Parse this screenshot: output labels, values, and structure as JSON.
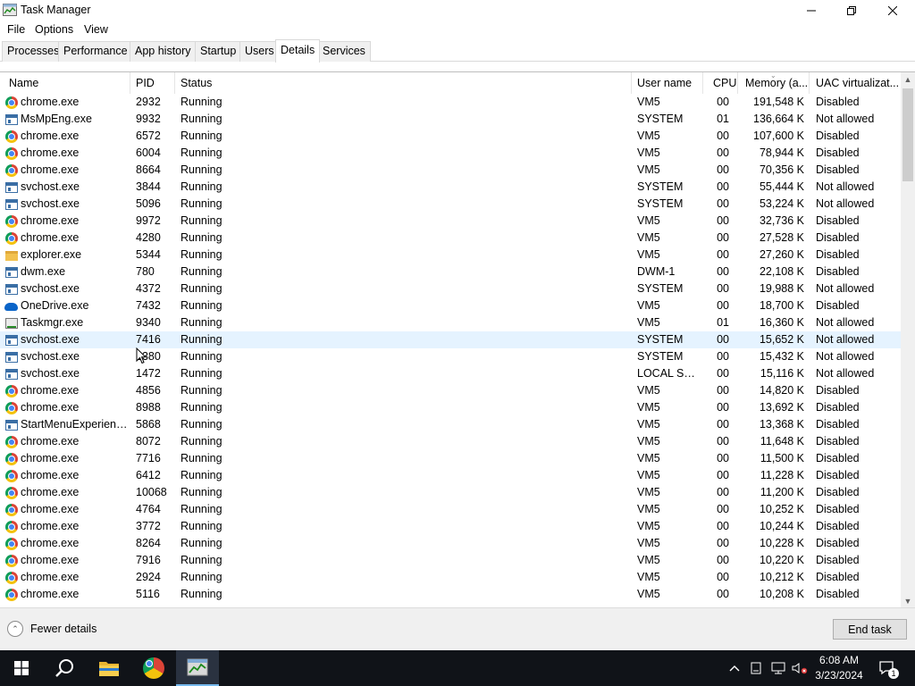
{
  "window": {
    "title": "Task Manager"
  },
  "menu": {
    "items": [
      "File",
      "Options",
      "View"
    ]
  },
  "tabs": [
    "Processes",
    "Performance",
    "App history",
    "Startup",
    "Users",
    "Details",
    "Services"
  ],
  "active_tab": "Details",
  "table": {
    "headers": {
      "name": "Name",
      "pid": "PID",
      "status": "Status",
      "user": "User name",
      "cpu": "CPU",
      "memory": "Memory (a...",
      "uac": "UAC virtualizat..."
    },
    "rows": [
      {
        "icon": "chrome-icon",
        "name": "chrome.exe",
        "pid": "2932",
        "status": "Running",
        "user": "VM5",
        "cpu": "00",
        "memory": "191,548 K",
        "uac": "Disabled"
      },
      {
        "icon": "service-icon",
        "name": "MsMpEng.exe",
        "pid": "9932",
        "status": "Running",
        "user": "SYSTEM",
        "cpu": "01",
        "memory": "136,664 K",
        "uac": "Not allowed"
      },
      {
        "icon": "chrome-icon",
        "name": "chrome.exe",
        "pid": "6572",
        "status": "Running",
        "user": "VM5",
        "cpu": "00",
        "memory": "107,600 K",
        "uac": "Disabled"
      },
      {
        "icon": "chrome-icon",
        "name": "chrome.exe",
        "pid": "6004",
        "status": "Running",
        "user": "VM5",
        "cpu": "00",
        "memory": "78,944 K",
        "uac": "Disabled"
      },
      {
        "icon": "chrome-icon",
        "name": "chrome.exe",
        "pid": "8664",
        "status": "Running",
        "user": "VM5",
        "cpu": "00",
        "memory": "70,356 K",
        "uac": "Disabled"
      },
      {
        "icon": "service-icon",
        "name": "svchost.exe",
        "pid": "3844",
        "status": "Running",
        "user": "SYSTEM",
        "cpu": "00",
        "memory": "55,444 K",
        "uac": "Not allowed"
      },
      {
        "icon": "service-icon",
        "name": "svchost.exe",
        "pid": "5096",
        "status": "Running",
        "user": "SYSTEM",
        "cpu": "00",
        "memory": "53,224 K",
        "uac": "Not allowed"
      },
      {
        "icon": "chrome-icon",
        "name": "chrome.exe",
        "pid": "9972",
        "status": "Running",
        "user": "VM5",
        "cpu": "00",
        "memory": "32,736 K",
        "uac": "Disabled"
      },
      {
        "icon": "chrome-icon",
        "name": "chrome.exe",
        "pid": "4280",
        "status": "Running",
        "user": "VM5",
        "cpu": "00",
        "memory": "27,528 K",
        "uac": "Disabled"
      },
      {
        "icon": "explorer-icon",
        "name": "explorer.exe",
        "pid": "5344",
        "status": "Running",
        "user": "VM5",
        "cpu": "00",
        "memory": "27,260 K",
        "uac": "Disabled"
      },
      {
        "icon": "service-icon",
        "name": "dwm.exe",
        "pid": "780",
        "status": "Running",
        "user": "DWM-1",
        "cpu": "00",
        "memory": "22,108 K",
        "uac": "Disabled"
      },
      {
        "icon": "service-icon",
        "name": "svchost.exe",
        "pid": "4372",
        "status": "Running",
        "user": "SYSTEM",
        "cpu": "00",
        "memory": "19,988 K",
        "uac": "Not allowed"
      },
      {
        "icon": "onedrive-icon",
        "name": "OneDrive.exe",
        "pid": "7432",
        "status": "Running",
        "user": "VM5",
        "cpu": "00",
        "memory": "18,700 K",
        "uac": "Disabled"
      },
      {
        "icon": "taskmgr-icon",
        "name": "Taskmgr.exe",
        "pid": "9340",
        "status": "Running",
        "user": "VM5",
        "cpu": "01",
        "memory": "16,360 K",
        "uac": "Not allowed"
      },
      {
        "icon": "service-icon",
        "name": "svchost.exe",
        "pid": "7416",
        "status": "Running",
        "user": "SYSTEM",
        "cpu": "00",
        "memory": "15,652 K",
        "uac": "Not allowed",
        "selected": true
      },
      {
        "icon": "service-icon",
        "name": "svchost.exe",
        "pid": "1380",
        "status": "Running",
        "user": "SYSTEM",
        "cpu": "00",
        "memory": "15,432 K",
        "uac": "Not allowed"
      },
      {
        "icon": "service-icon",
        "name": "svchost.exe",
        "pid": "1472",
        "status": "Running",
        "user": "LOCAL SE...",
        "cpu": "00",
        "memory": "15,116 K",
        "uac": "Not allowed"
      },
      {
        "icon": "chrome-icon",
        "name": "chrome.exe",
        "pid": "4856",
        "status": "Running",
        "user": "VM5",
        "cpu": "00",
        "memory": "14,820 K",
        "uac": "Disabled"
      },
      {
        "icon": "chrome-icon",
        "name": "chrome.exe",
        "pid": "8988",
        "status": "Running",
        "user": "VM5",
        "cpu": "00",
        "memory": "13,692 K",
        "uac": "Disabled"
      },
      {
        "icon": "service-icon",
        "name": "StartMenuExperienc...",
        "pid": "5868",
        "status": "Running",
        "user": "VM5",
        "cpu": "00",
        "memory": "13,368 K",
        "uac": "Disabled"
      },
      {
        "icon": "chrome-icon",
        "name": "chrome.exe",
        "pid": "8072",
        "status": "Running",
        "user": "VM5",
        "cpu": "00",
        "memory": "11,648 K",
        "uac": "Disabled"
      },
      {
        "icon": "chrome-icon",
        "name": "chrome.exe",
        "pid": "7716",
        "status": "Running",
        "user": "VM5",
        "cpu": "00",
        "memory": "11,500 K",
        "uac": "Disabled"
      },
      {
        "icon": "chrome-icon",
        "name": "chrome.exe",
        "pid": "6412",
        "status": "Running",
        "user": "VM5",
        "cpu": "00",
        "memory": "11,228 K",
        "uac": "Disabled"
      },
      {
        "icon": "chrome-icon",
        "name": "chrome.exe",
        "pid": "10068",
        "status": "Running",
        "user": "VM5",
        "cpu": "00",
        "memory": "11,200 K",
        "uac": "Disabled"
      },
      {
        "icon": "chrome-icon",
        "name": "chrome.exe",
        "pid": "4764",
        "status": "Running",
        "user": "VM5",
        "cpu": "00",
        "memory": "10,252 K",
        "uac": "Disabled"
      },
      {
        "icon": "chrome-icon",
        "name": "chrome.exe",
        "pid": "3772",
        "status": "Running",
        "user": "VM5",
        "cpu": "00",
        "memory": "10,244 K",
        "uac": "Disabled"
      },
      {
        "icon": "chrome-icon",
        "name": "chrome.exe",
        "pid": "8264",
        "status": "Running",
        "user": "VM5",
        "cpu": "00",
        "memory": "10,228 K",
        "uac": "Disabled"
      },
      {
        "icon": "chrome-icon",
        "name": "chrome.exe",
        "pid": "7916",
        "status": "Running",
        "user": "VM5",
        "cpu": "00",
        "memory": "10,220 K",
        "uac": "Disabled"
      },
      {
        "icon": "chrome-icon",
        "name": "chrome.exe",
        "pid": "2924",
        "status": "Running",
        "user": "VM5",
        "cpu": "00",
        "memory": "10,212 K",
        "uac": "Disabled"
      },
      {
        "icon": "chrome-icon",
        "name": "chrome.exe",
        "pid": "5116",
        "status": "Running",
        "user": "VM5",
        "cpu": "00",
        "memory": "10,208 K",
        "uac": "Disabled"
      }
    ]
  },
  "footer": {
    "fewer_details": "Fewer details",
    "end_task": "End task"
  },
  "taskbar": {
    "pinned": [
      "start-icon",
      "search-icon",
      "file-explorer-icon",
      "chrome-icon",
      "task-manager-icon"
    ],
    "time": "6:08 AM",
    "date": "3/23/2024",
    "notification_count": "1"
  },
  "colors": {
    "selected_row": "#e5f3ff",
    "taskbar": "#101318",
    "accent": "#76b9ed"
  }
}
